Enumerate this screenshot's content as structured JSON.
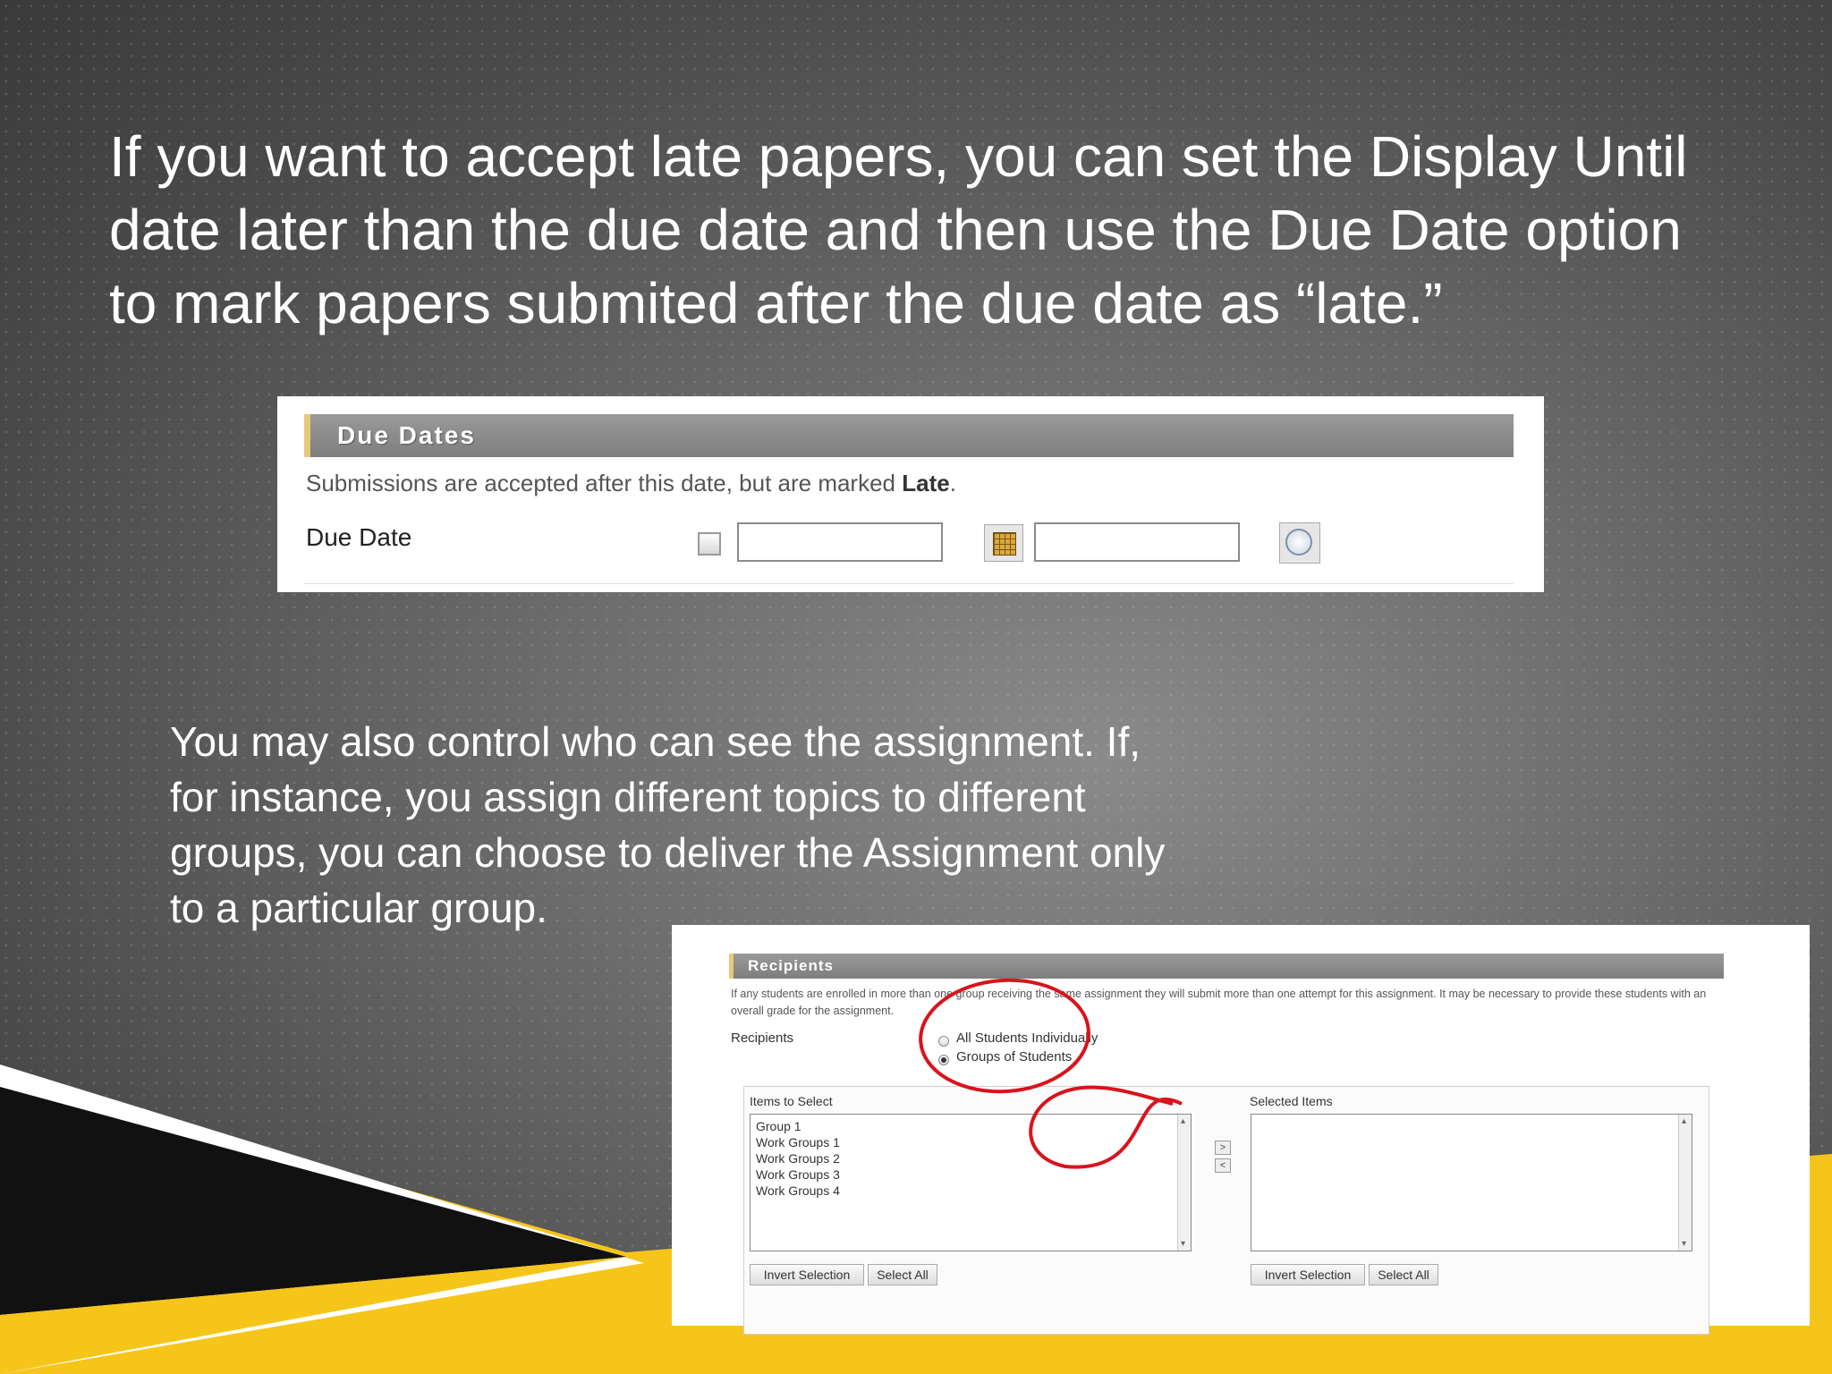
{
  "slide": {
    "heading": "If you want to accept late papers, you can set the Display Until date later than the due date and then use the Due Date option to mark papers submited after the due date as “late.”",
    "body": "You may also control who can see the assignment. If, for instance, you assign different topics to different groups, you can choose to deliver the Assignment only to a particular group."
  },
  "colors": {
    "accent": "#f6c51a",
    "swoosh_dark": "#111111",
    "annotation": "#d8141c"
  },
  "due_dates": {
    "title": "Due Dates",
    "instructions_prefix": "Submissions are accepted after this date, but are marked ",
    "instructions_bold": "Late",
    "instructions_suffix": ".",
    "field_label": "Due Date",
    "date_value": "",
    "time_value": "",
    "icons": {
      "calendar": "calendar-icon",
      "clock": "clock-icon"
    }
  },
  "recipients": {
    "title": "Recipients",
    "note": "If any students are enrolled in more than one group receiving the same assignment they will submit more than one attempt for this assignment. It may be necessary to provide these students with an overall grade for the assignment.",
    "label": "Recipients",
    "options": [
      "All Students Individually",
      "Groups of Students"
    ],
    "selected_option": "Groups of Students",
    "items_title": "Items to Select",
    "selected_title": "Selected Items",
    "items": [
      "Group 1",
      "Work Groups 1",
      "Work Groups 2",
      "Work Groups 3",
      "Work Groups 4"
    ],
    "selected_items": [],
    "buttons": {
      "invert": "Invert Selection",
      "select_all": "Select All",
      "move_right": ">",
      "move_left": "<"
    }
  }
}
